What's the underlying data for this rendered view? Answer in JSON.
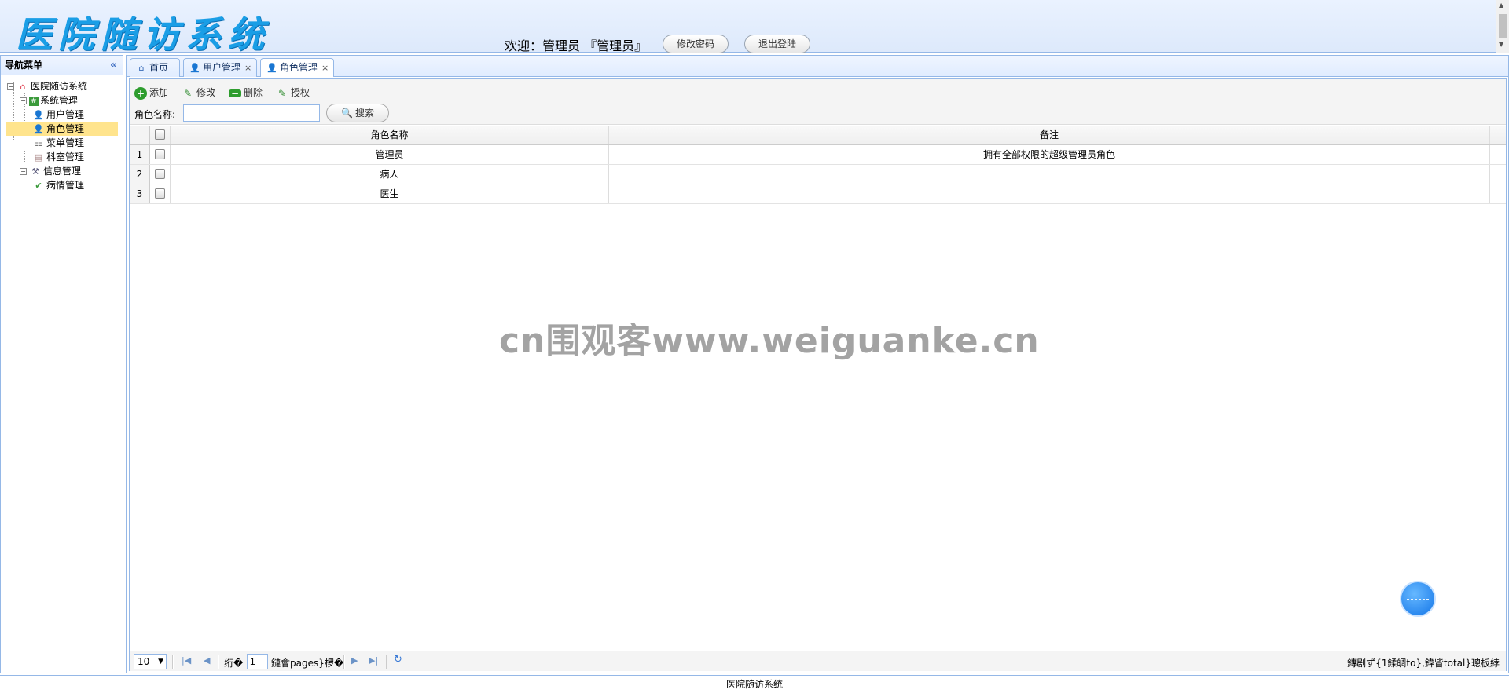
{
  "header": {
    "logo": "医院随访系统",
    "welcome": "欢迎：管理员 『管理员』",
    "change_password": "修改密码",
    "logout": "退出登陆"
  },
  "nav": {
    "title": "导航菜单",
    "collapse_icon": "double-chevron-left-icon",
    "tree": {
      "root": "医院随访系统",
      "system_group": "系统管理",
      "system_items": [
        "用户管理",
        "角色管理",
        "菜单管理",
        "科室管理"
      ],
      "info_group": "信息管理",
      "info_items": [
        "病情管理"
      ],
      "selected": "角色管理"
    }
  },
  "tabs": [
    {
      "label": "首页",
      "closable": false,
      "icon": "home-icon"
    },
    {
      "label": "用户管理",
      "closable": true,
      "icon": "user-icon"
    },
    {
      "label": "角色管理",
      "closable": true,
      "icon": "role-icon",
      "active": true
    }
  ],
  "toolbar": {
    "add": "添加",
    "edit": "修改",
    "delete": "删除",
    "authorize": "授权",
    "search_label": "角色名称:",
    "search_value": "",
    "search_button": "搜索"
  },
  "table": {
    "columns": [
      "角色名称",
      "备注"
    ],
    "rows": [
      {
        "num": "1",
        "name": "管理员",
        "note": "拥有全部权限的超级管理员角色"
      },
      {
        "num": "2",
        "name": "病人",
        "note": ""
      },
      {
        "num": "3",
        "name": "医生",
        "note": ""
      }
    ]
  },
  "watermark": "cn围观客www.weiguanke.cn",
  "pager": {
    "page_size": "10",
    "before_page": "绗�",
    "page_value": "1",
    "after_page": "鏈會pages}椤�",
    "info": "鏄剧ず{1鍒皗to},鍏眥total}璁板綍"
  },
  "footer": "医院随访系统",
  "colors": {
    "border": "#95b8e7",
    "logo": "#1a9ee6",
    "selected": "#ffe48d"
  }
}
